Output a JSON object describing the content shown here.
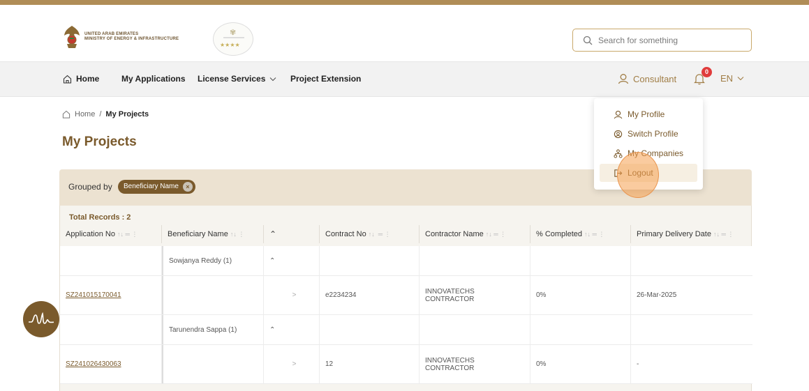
{
  "header": {
    "ministry_line1": "UNITED ARAB EMIRATES",
    "ministry_line2": "MINISTRY OF ENERGY & INFRASTRUCTURE",
    "award_stars": "★★★★",
    "search_placeholder": "Search for something"
  },
  "nav": {
    "items": [
      {
        "label": "Home",
        "icon": "home-icon"
      },
      {
        "label": "My Applications"
      },
      {
        "label": "License Services",
        "icon": "chevron-down-icon"
      },
      {
        "label": "Project Extension"
      }
    ],
    "user_label": "Consultant",
    "notification_count": "0",
    "language": "EN"
  },
  "breadcrumb": {
    "home": "Home",
    "separator": "/",
    "current": "My Projects"
  },
  "page_title": "My Projects",
  "grouping": {
    "label": "Grouped by",
    "chip": "Beneficiary Name",
    "chip_remove": "×"
  },
  "table": {
    "total_records": "Total Records : 2",
    "columns": [
      "Application No",
      "Beneficiary Name",
      "",
      "Contract No",
      "Contractor Name",
      "% Completed",
      "Primary Delivery Date"
    ],
    "groups": [
      {
        "beneficiary": "Sowjanya Reddy (1)",
        "rows": [
          {
            "application_no": "SZ241015170041",
            "contract_no": "e2234234",
            "contractor_line1": "INNOVATECHS",
            "contractor_line2": "CONTRACTOR",
            "completed": "0%",
            "delivery_date": "26-Mar-2025"
          }
        ]
      },
      {
        "beneficiary": "Tarunendra Sappa (1)",
        "rows": [
          {
            "application_no": "SZ241026430063",
            "contract_no": "12",
            "contractor_line1": "INNOVATECHS",
            "contractor_line2": "CONTRACTOR",
            "completed": "0%",
            "delivery_date": "-"
          }
        ]
      }
    ]
  },
  "profile_menu": {
    "items": [
      {
        "label": "My Profile",
        "icon": "user-icon"
      },
      {
        "label": "Switch Profile",
        "icon": "switch-profile-icon"
      },
      {
        "label": "My Companies",
        "icon": "companies-icon"
      },
      {
        "label": "Logout",
        "icon": "logout-icon"
      }
    ]
  },
  "colors": {
    "brand": "#7a5a2c",
    "accent_gold": "#b08d57",
    "panel": "#ece2d1",
    "badge": "#e03b3b",
    "highlight": "#e9954f"
  }
}
